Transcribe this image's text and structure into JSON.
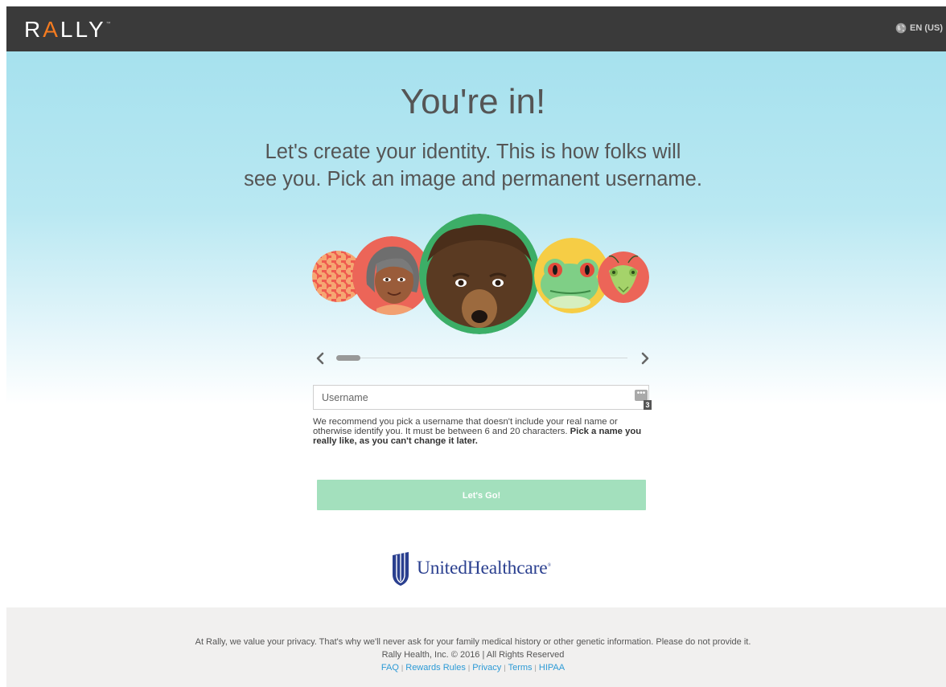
{
  "header": {
    "logo_pre": "R",
    "logo_accent": "A",
    "logo_post": "LLY",
    "language_label": "EN (US)"
  },
  "hero": {
    "title": "You're in!",
    "subtitle_line1": "Let's create your identity. This is how folks will",
    "subtitle_line2": "see you. Pick an image and permanent username."
  },
  "avatars": [
    "houndstooth",
    "woman",
    "bear",
    "frog",
    "mantis"
  ],
  "form": {
    "username_placeholder": "Username",
    "password_manager_count": "3",
    "help_text": "We recommend you pick a username that doesn't include your real name or otherwise identify you. It must be between 6 and 20 characters.",
    "help_bold": "Pick a name you really like, as you can't change it later.",
    "submit_label": "Let's Go!"
  },
  "partner": {
    "logo_text": "UnitedHealthcare",
    "trademark": "®"
  },
  "footer": {
    "privacy_note": "At Rally, we value your privacy. That's why we'll never ask for your family medical history or other genetic information. Please do not provide it.",
    "copyright": "Rally Health, Inc. © 2016 | All Rights Reserved",
    "links": [
      "FAQ",
      "Rewards Rules",
      "Privacy",
      "Terms",
      "HIPAA"
    ]
  },
  "colors": {
    "header_bg": "#3a3a3a",
    "accent": "#f47b20",
    "button_green": "#a3e0bd",
    "link_blue": "#2c9ad6",
    "uhc_blue": "#2a3f8f"
  }
}
